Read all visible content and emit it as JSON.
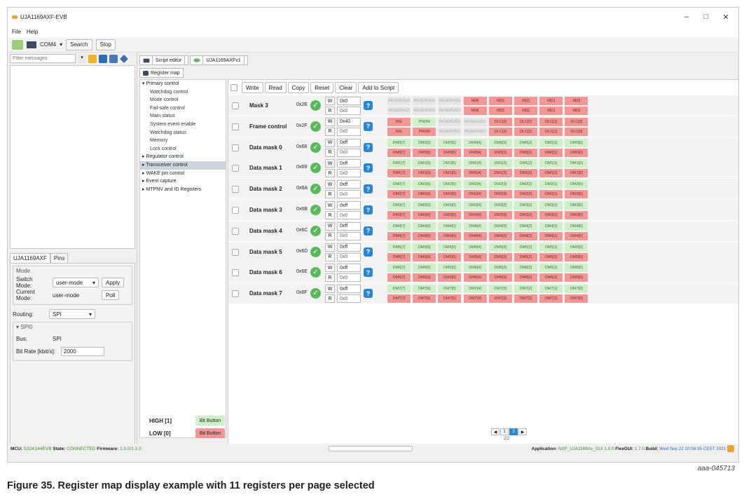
{
  "window": {
    "title": "UJA1169AXF-EVB",
    "controls": [
      "–",
      "□",
      "✕"
    ]
  },
  "menu": [
    "File",
    "Help"
  ],
  "toolbar": {
    "port": "COM4",
    "search": "Search",
    "stop": "Stop"
  },
  "left": {
    "filter_placeholder": "Filter messages",
    "tabs": [
      "UJA1169AXF",
      "Pins"
    ],
    "mode": {
      "legend": "Mode",
      "switch_label": "Switch Mode:",
      "switch_value": "user-mode",
      "apply": "Apply",
      "current_label": "Current Mode:",
      "current_value": "user-mode",
      "poll": "Poll"
    },
    "routing_label": "Routing:",
    "routing_value": "SPI",
    "spi": {
      "legend": "SPI0",
      "bus_label": "Bus:",
      "bus_value": "SPI",
      "bitrate_label": "Bit Rate [kbit/s]:",
      "bitrate_value": "2000"
    }
  },
  "doc_tabs": [
    "Script editor",
    "UJA1169AXFv1"
  ],
  "register_tab": "Register map",
  "tree": [
    {
      "label": "▾ Primary control",
      "level": 0
    },
    {
      "label": "Watchdog control",
      "level": 1
    },
    {
      "label": "Mode control",
      "level": 1
    },
    {
      "label": "Fail-safe control",
      "level": 1
    },
    {
      "label": "Main status",
      "level": 1
    },
    {
      "label": "System event enable",
      "level": 1
    },
    {
      "label": "Watchdog status",
      "level": 1
    },
    {
      "label": "Memory",
      "level": 1
    },
    {
      "label": "Lock control",
      "level": 1
    },
    {
      "label": "▸ Regulator control",
      "level": 0
    },
    {
      "label": "▸ Transceiver control",
      "level": 0,
      "selected": true
    },
    {
      "label": "▸ WAKE pin control",
      "level": 0
    },
    {
      "label": "▸ Event capture",
      "level": 0
    },
    {
      "label": "▸ MTPNV and ID Registers",
      "level": 0
    }
  ],
  "high_low": [
    {
      "label": "HIGH [1]",
      "button": "Bit Button",
      "color": "#cff0c9"
    },
    {
      "label": "LOW [0]",
      "button": "Bit Button",
      "color": "#f29696"
    }
  ],
  "actions": [
    "Write",
    "Read",
    "Copy",
    "Reset",
    "Clear",
    "Add to Script"
  ],
  "registers": [
    {
      "name": "Mask 3",
      "addr": "0x2E",
      "w": "0x0",
      "r": "0x0",
      "wbits": [
        "RESERVED",
        "RESERVED",
        "RESERVED",
        "M[4]",
        "M[3]",
        "M[2]",
        "M[1]",
        "M[0]"
      ],
      "wcol": [
        "gr",
        "gr",
        "gr",
        "r",
        "r",
        "r",
        "r",
        "r"
      ],
      "rbits": [
        "RESERVED",
        "RESERVED",
        "RESERVED",
        "M[4]",
        "M[3]",
        "M[2]",
        "M[1]",
        "M[0]"
      ],
      "rcol": [
        "gr",
        "gr",
        "gr",
        "r",
        "r",
        "r",
        "r",
        "r"
      ]
    },
    {
      "name": "Frame control",
      "addr": "0x2F",
      "w": "0x40",
      "r": "0x0",
      "wbits": [
        "IDE",
        "PNDM",
        "RESERVED",
        "RESERVED",
        "DLC[3]",
        "DLC[2]",
        "DLC[1]",
        "DLC[0]"
      ],
      "wcol": [
        "r",
        "g",
        "gr",
        "gr",
        "r",
        "r",
        "r",
        "r"
      ],
      "rbits": [
        "IDE",
        "PNDM",
        "RESERVED",
        "RESERVED",
        "DLC[3]",
        "DLC[2]",
        "DLC[1]",
        "DLC[0]"
      ],
      "rcol": [
        "r",
        "r",
        "gr",
        "gr",
        "r",
        "r",
        "r",
        "r"
      ]
    },
    {
      "name": "Data mask 0",
      "addr": "0x68",
      "w": "0xff",
      "r": "0x0",
      "p": "DM0"
    },
    {
      "name": "Data mask 1",
      "addr": "0x69",
      "w": "0xff",
      "r": "0x0",
      "p": "DM1"
    },
    {
      "name": "Data mask 2",
      "addr": "0x6A",
      "w": "0xff",
      "r": "0x0",
      "p": "DM2"
    },
    {
      "name": "Data mask 3",
      "addr": "0x6B",
      "w": "0xff",
      "r": "0x0",
      "p": "DM3"
    },
    {
      "name": "Data mask 4",
      "addr": "0x6C",
      "w": "0xff",
      "r": "0x0",
      "p": "DM4"
    },
    {
      "name": "Data mask 5",
      "addr": "0x6D",
      "w": "0xff",
      "r": "0x0",
      "p": "DM5"
    },
    {
      "name": "Data mask 6",
      "addr": "0x6E",
      "w": "0xff",
      "r": "0x0",
      "p": "DM6"
    },
    {
      "name": "Data mask 7",
      "addr": "0x6F",
      "w": "0xff",
      "r": "0x0",
      "p": "DM7"
    }
  ],
  "pager": {
    "pages": [
      "1",
      "2"
    ],
    "current": "2",
    "label": "2/2"
  },
  "status": {
    "mcu_label": "MCU:",
    "mcu_value": "S32K144EVB",
    "state_label": "State:",
    "state_value": "CONNECTED",
    "fw_label": "Firmware:",
    "fw_value": "1.0.0/1.1.0",
    "app_label": "Application:",
    "app_value": "NXP_UJA1169Ax_GUI 1.0.0",
    "flex_label": "FlexGUI:",
    "flex_value": "1.7.0",
    "build_label": "Build:",
    "build_value": "Wed Sep 22 10:08:35 CEST 2021"
  },
  "ref": "aaa-045713",
  "caption": "Figure 35.  Register map display example with 11 registers per page selected"
}
